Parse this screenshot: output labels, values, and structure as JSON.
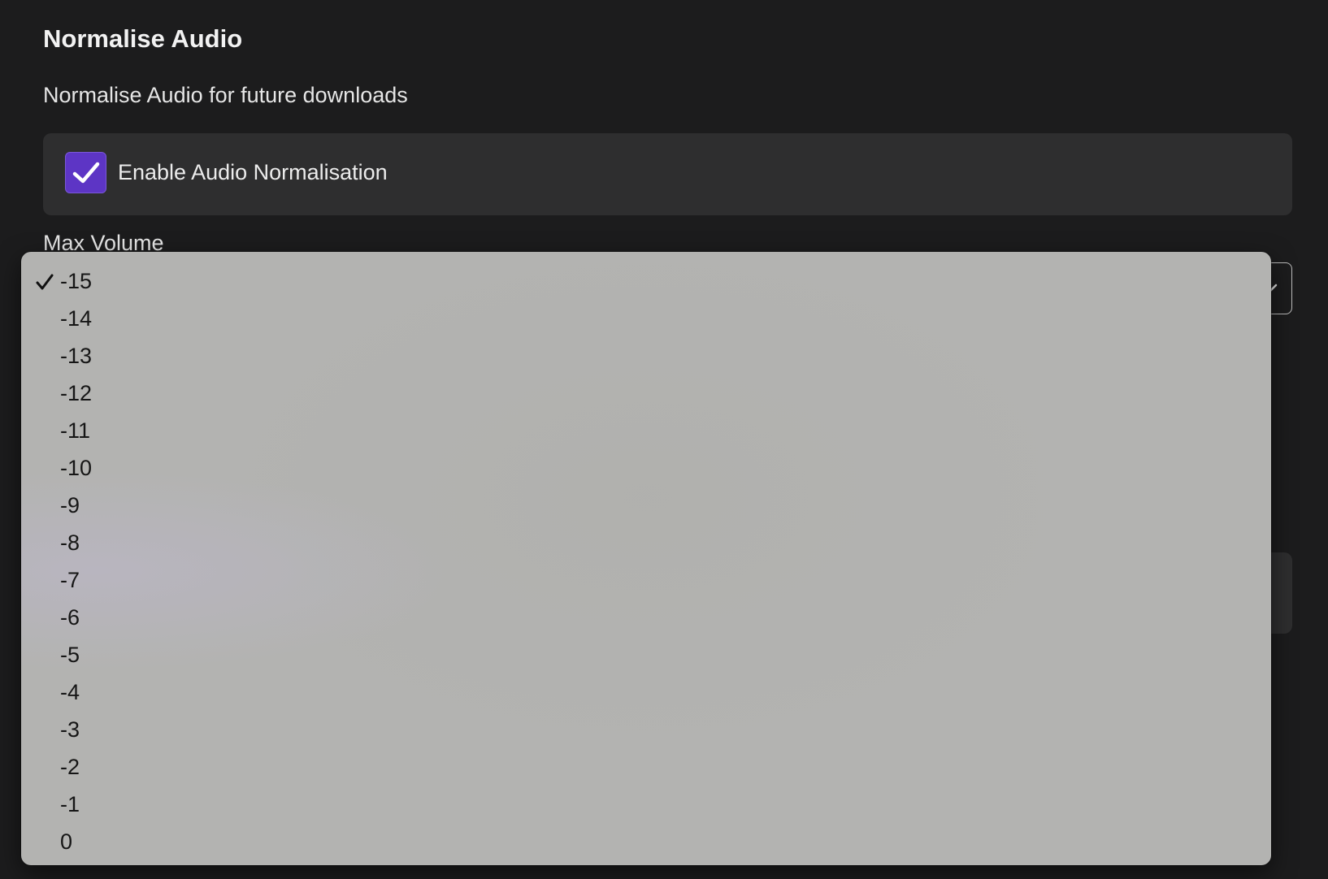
{
  "section": {
    "title": "Normalise Audio",
    "description": "Normalise Audio for future downloads"
  },
  "normalisation_toggle": {
    "label": "Enable Audio Normalisation",
    "checked": true,
    "accent_color": "#5d35c5"
  },
  "max_volume": {
    "label": "Max Volume",
    "selected": "-15",
    "options": [
      "-15",
      "-14",
      "-13",
      "-12",
      "-11",
      "-10",
      "-9",
      "-8",
      "-7",
      "-6",
      "-5",
      "-4",
      "-3",
      "-2",
      "-1",
      "0"
    ]
  },
  "icons": {
    "checkbox": "checkmark-icon",
    "selected_option": "checkmark-icon",
    "select_trigger": "chevron-down-icon"
  },
  "colors": {
    "background": "#1c1c1d",
    "card": "#2e2e2f",
    "dropdown": "#b3b3b1"
  }
}
